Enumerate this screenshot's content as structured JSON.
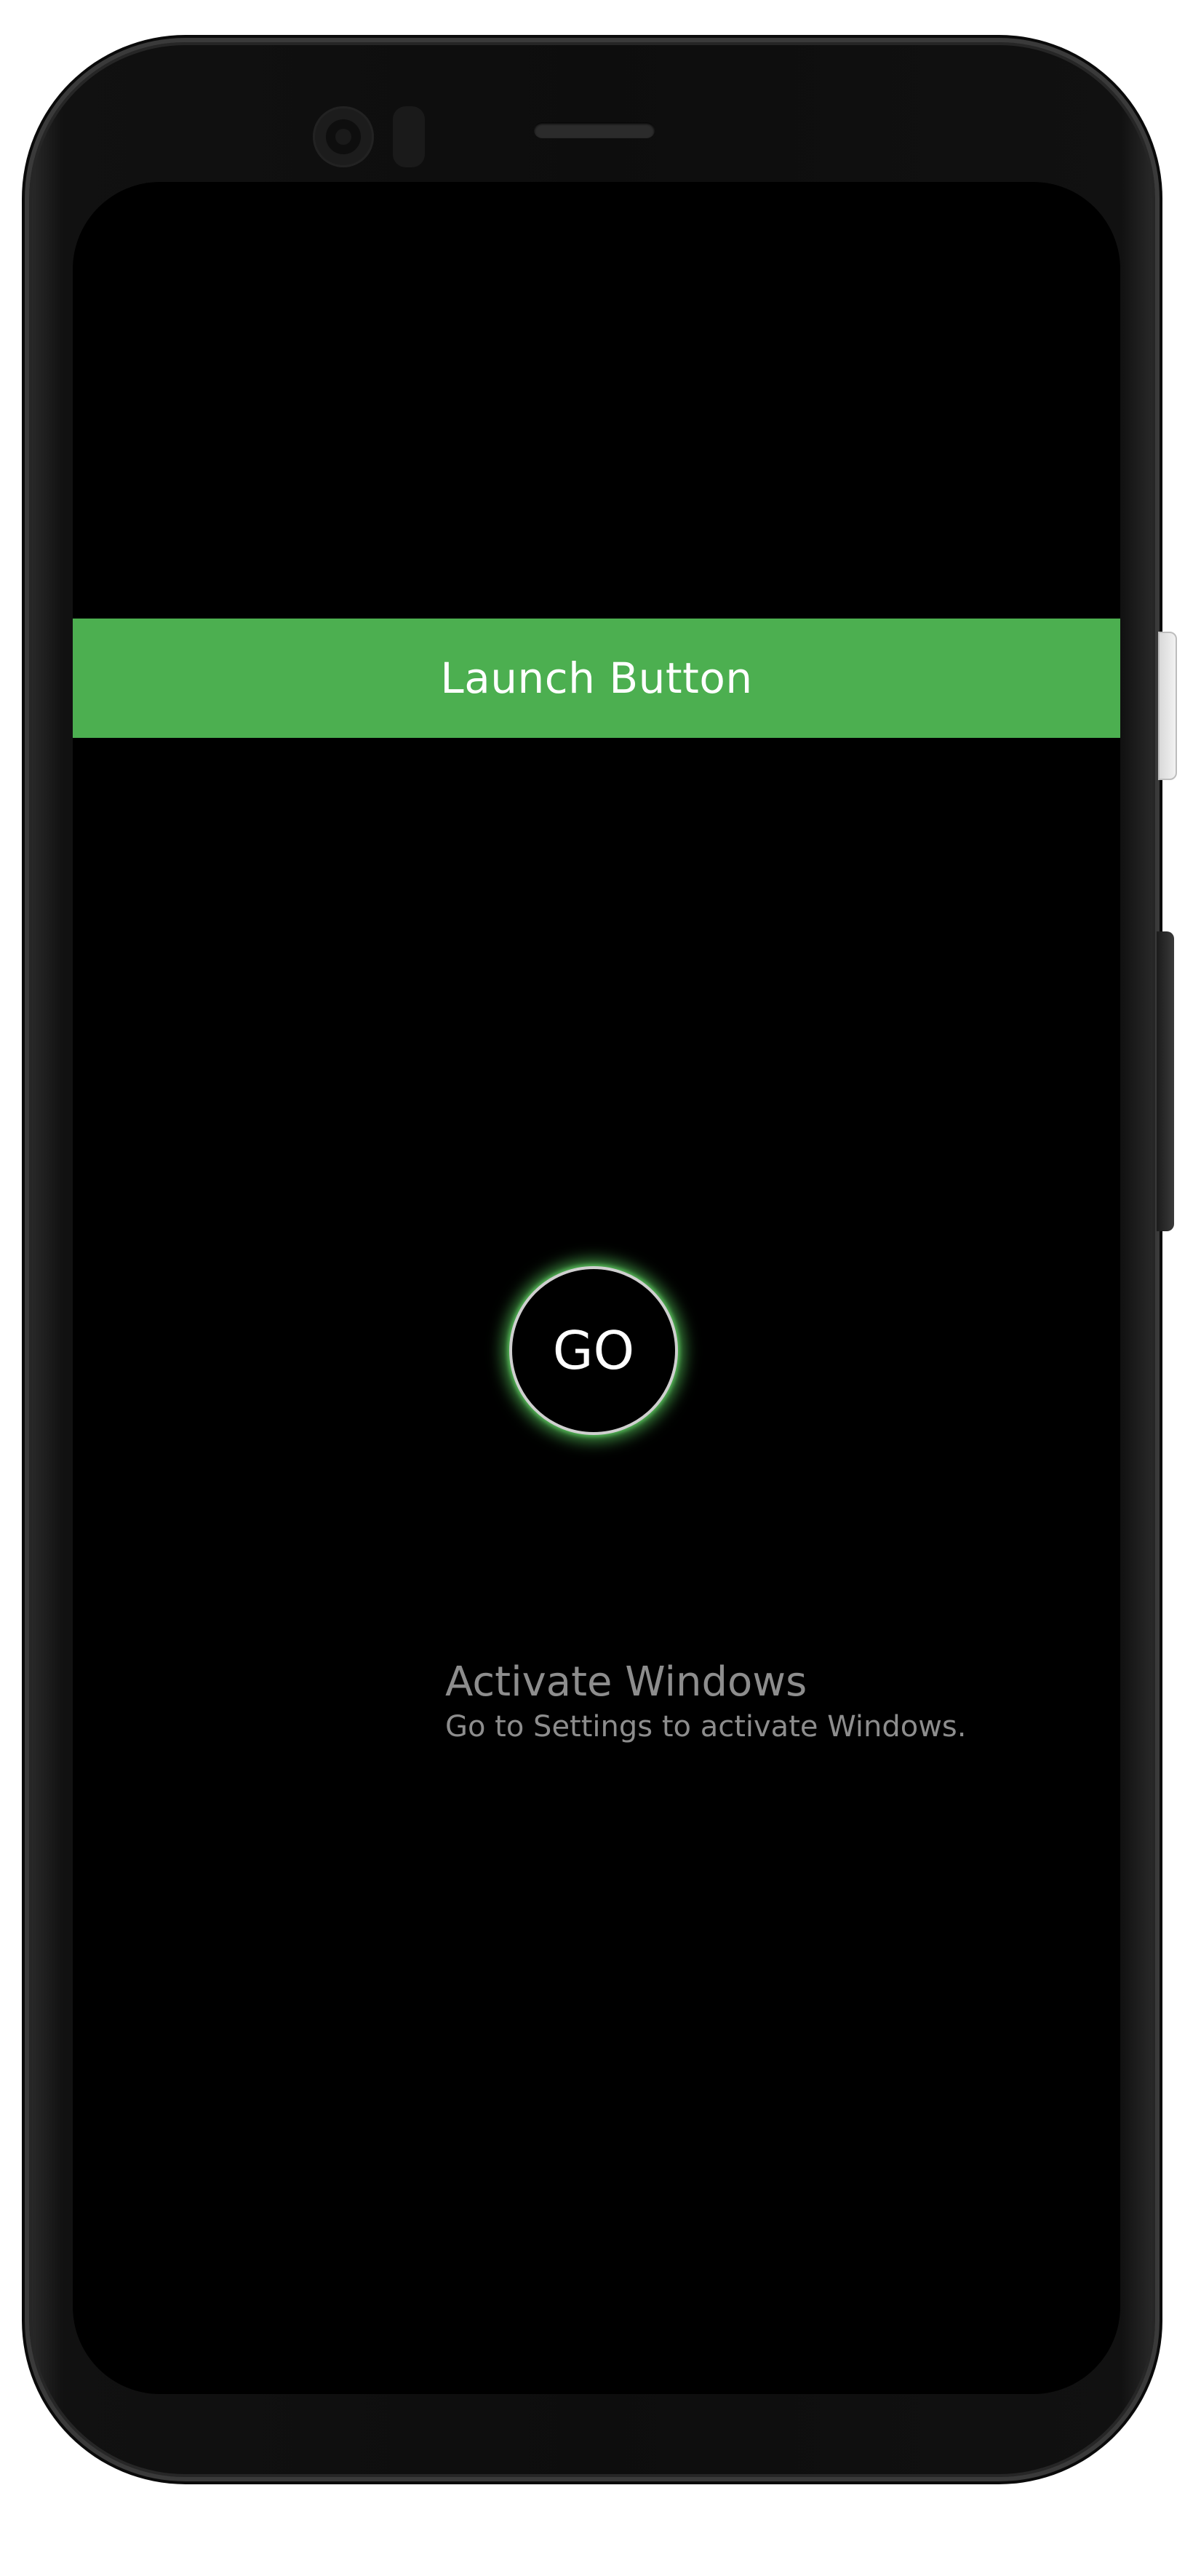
{
  "device": {
    "frame_color": "#111111",
    "screen_color": "#000000"
  },
  "app": {
    "launch_button": {
      "label": "Launch Button",
      "color": "#4caf50"
    },
    "go_button": {
      "label": "GO",
      "glow_color": "#4caf50"
    }
  },
  "watermark": {
    "title": "Activate Windows",
    "subtitle": "Go to Settings to activate Windows."
  }
}
